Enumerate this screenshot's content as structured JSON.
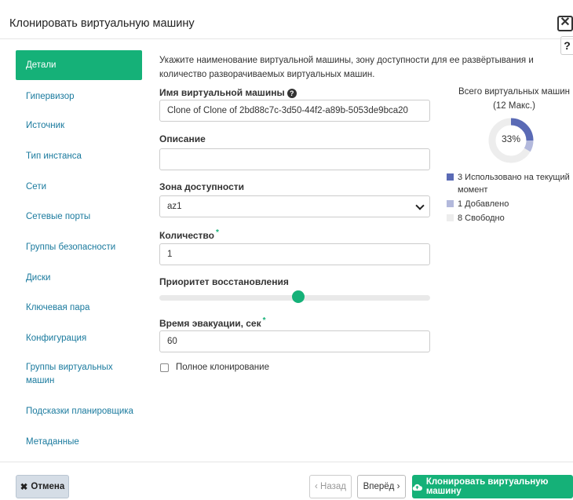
{
  "modal": {
    "title": "Клонировать виртуальную машину",
    "close_glyph": "✕",
    "help_glyph": "?"
  },
  "nav": {
    "items": [
      {
        "label": "Детали",
        "active": true
      },
      {
        "label": "Гипервизор"
      },
      {
        "label": "Источник"
      },
      {
        "label": "Тип инстанса"
      },
      {
        "label": "Сети"
      },
      {
        "label": "Сетевые порты"
      },
      {
        "label": "Группы безопасности"
      },
      {
        "label": "Диски"
      },
      {
        "label": "Ключевая пара"
      },
      {
        "label": "Конфигурация"
      },
      {
        "label": "Группы виртуальных машин"
      },
      {
        "label": "Подсказки планировщика"
      },
      {
        "label": "Метаданные"
      }
    ]
  },
  "form": {
    "intro": "Укажите наименование виртуальной машины, зону доступности для ее развёртывания и количество разворачиваемых виртуальных машин.",
    "name_label": "Имя виртуальной машины",
    "name_value": "Clone of Clone of 2bd88c7c-3d50-44f2-a89b-5053de9bca20",
    "description_label": "Описание",
    "description_value": "",
    "zone_label": "Зона доступности",
    "zone_value": "az1",
    "count_label": "Количество",
    "count_value": "1",
    "priority_label": "Приоритет восстановления",
    "priority_fraction": 0.5,
    "evac_label": "Время эвакуации, сек",
    "evac_value": "60",
    "full_clone_label": "Полное клонирование",
    "full_clone_checked": false
  },
  "summary": {
    "title_line1": "Всего виртуальных машин",
    "title_line2": "(12 Макс.)",
    "percent_label": "33%",
    "used": 3,
    "added": 1,
    "free": 8,
    "max": 12,
    "legend_used": "3 Использовано на текущий момент",
    "legend_added": "1 Добавлено",
    "legend_free": "8 Свободно",
    "colors": {
      "used": "#5a6ab5",
      "added": "#b3b9dc",
      "free": "#ededed"
    }
  },
  "footer": {
    "cancel_label": "Отмена",
    "back_label": "‹ Назад",
    "next_label": "Вперёд ›",
    "clone_label": "Клонировать виртуальную машину"
  },
  "colors": {
    "accent": "#15b178",
    "link": "#1a7a9e"
  }
}
